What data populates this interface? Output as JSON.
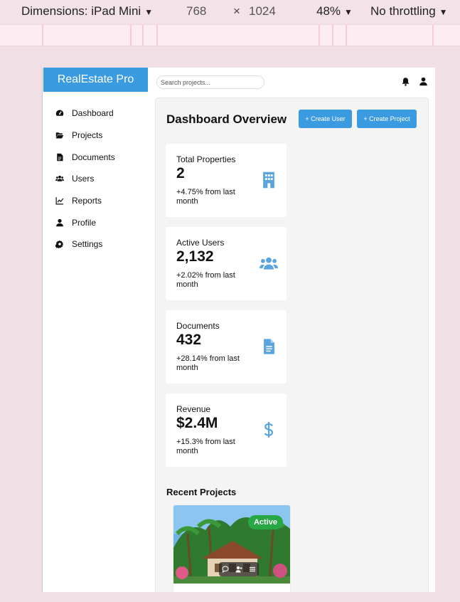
{
  "devtools": {
    "device": "Dimensions: iPad Mini",
    "width": "768",
    "times": "×",
    "height": "1024",
    "zoom": "48%",
    "throttling": "No throttling"
  },
  "app": {
    "brand": "RealEstate Pro"
  },
  "search": {
    "placeholder": "Search projects..."
  },
  "sidebar": {
    "items": [
      {
        "label": "Dashboard",
        "icon": "gauge-icon"
      },
      {
        "label": "Projects",
        "icon": "folder-open-icon"
      },
      {
        "label": "Documents",
        "icon": "file-icon"
      },
      {
        "label": "Users",
        "icon": "users-icon"
      },
      {
        "label": "Reports",
        "icon": "chart-line-icon"
      },
      {
        "label": "Profile",
        "icon": "user-icon"
      },
      {
        "label": "Settings",
        "icon": "gear-icon"
      }
    ]
  },
  "header": {
    "title": "Dashboard Overview",
    "create_user": "+ Create User",
    "create_project": "+ Create Project"
  },
  "stats": [
    {
      "label": "Total Properties",
      "value": "2",
      "change": "+4.75% from last month",
      "icon": "building-icon"
    },
    {
      "label": "Active Users",
      "value": "2,132",
      "change": "+2.02% from last month",
      "icon": "users-icon"
    },
    {
      "label": "Documents",
      "value": "432",
      "change": "+28.14% from last month",
      "icon": "file-icon"
    },
    {
      "label": "Revenue",
      "value": "$2.4M",
      "change": "+15.3% from last month",
      "icon": "dollar-icon"
    }
  ],
  "recent": {
    "title": "Recent Projects",
    "projects": [
      {
        "status": "Active"
      }
    ]
  },
  "colors": {
    "accent": "#3b9be0",
    "icon": "#5aa5dd",
    "status_active": "#28a745"
  }
}
